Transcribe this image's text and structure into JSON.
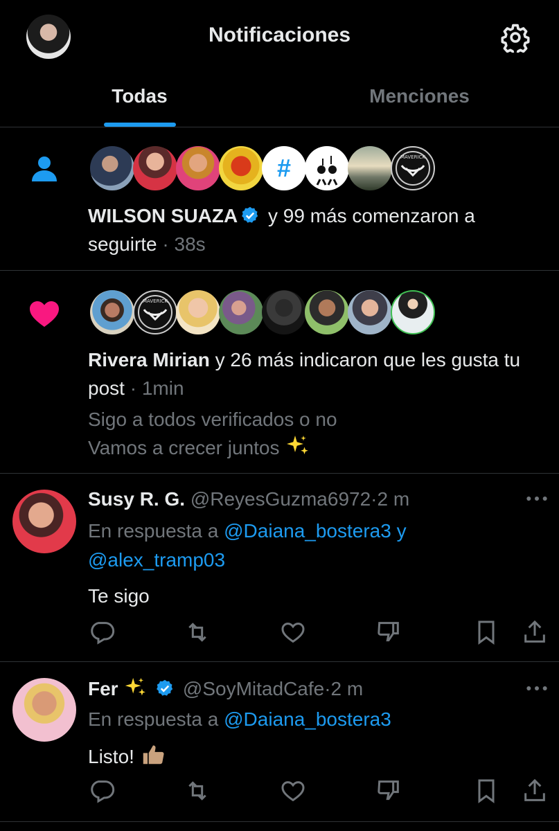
{
  "header": {
    "title": "Notificaciones",
    "tabs": [
      {
        "label": "Todas",
        "active": true
      },
      {
        "label": "Menciones",
        "active": false
      }
    ]
  },
  "colors": {
    "accent": "#1d9bf0",
    "like": "#f91880",
    "muted": "#71767b",
    "text": "#e7e9ea",
    "divider": "#2f3336"
  },
  "notifications": [
    {
      "type": "follow",
      "icon": "person-icon",
      "name": "WILSON SUAZA",
      "verified": true,
      "text": "y 99 más comenzaron a seguirte",
      "time": "38s"
    },
    {
      "type": "like",
      "icon": "heart-icon",
      "name": "Rivera Mirian",
      "text": "y 26 más indicaron que les gusta tu post",
      "time": "1min",
      "post_line1": "Sigo a todos verificados o no",
      "post_line2": "Vamos a crecer juntos"
    }
  ],
  "tweets": [
    {
      "name": "Susy R. G.",
      "handle": "@ReyesGuzma6972",
      "time": "2 m",
      "reply_prefix": "En respuesta a",
      "reply_to_1": "@Daiana_bostera3",
      "reply_join": "y",
      "reply_to_2": "@alex_tramp03",
      "body": "Te sigo"
    },
    {
      "name": "Fer",
      "verified": true,
      "handle": "@SoyMitadCafe",
      "time": "2 m",
      "reply_prefix": "En respuesta a",
      "reply_to_1": "@Daiana_bostera3",
      "body": "Listo!"
    }
  ],
  "separator": "·",
  "badge_text": "MAVERICK"
}
